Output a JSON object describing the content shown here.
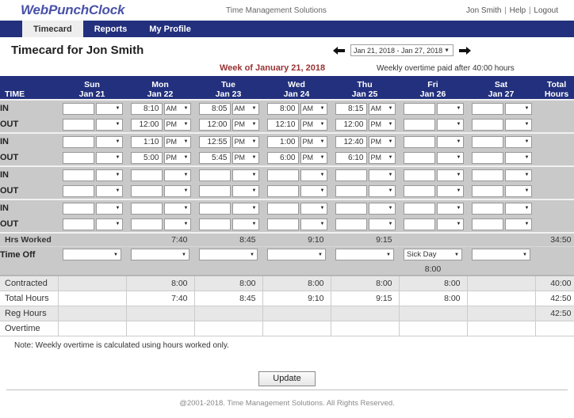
{
  "brand": {
    "logo": "WebPunchClock",
    "tagline": "Time Management Solutions"
  },
  "user_links": {
    "name": "Jon Smith",
    "help": "Help",
    "logout": "Logout",
    "separator": "|"
  },
  "nav": {
    "tabs": [
      {
        "label": "Timecard",
        "active": true
      },
      {
        "label": "Reports",
        "active": false
      },
      {
        "label": "My Profile",
        "active": false
      }
    ]
  },
  "page": {
    "title": "Timecard for Jon Smith",
    "week_label": "Week of January 21, 2018",
    "overtime_note": "Weekly overtime paid after 40:00 hours",
    "footer_note": "Note: Weekly overtime is calculated using hours worked only.",
    "update_button": "Update",
    "copyright": "@2001-2018. Time Management Solutions. All Rights Reserved."
  },
  "date_nav": {
    "prev_icon": "left-arrow-icon",
    "next_icon": "right-arrow-icon",
    "selected_range": "Jan 21, 2018 - Jan 27, 2018",
    "caret": "▼"
  },
  "colors": {
    "brand_blue": "#23307d",
    "logo_purple": "#4a52a8",
    "week_red": "#993333",
    "row_gray": "#c9c9c9",
    "summary_shade": "#e7e7e7"
  },
  "table": {
    "time_column_header": "TIME",
    "total_header_line1": "Total",
    "total_header_line2": "Hours",
    "days": [
      {
        "dow": "Sun",
        "date": "Jan 21"
      },
      {
        "dow": "Mon",
        "date": "Jan 22"
      },
      {
        "dow": "Tue",
        "date": "Jan 23"
      },
      {
        "dow": "Wed",
        "date": "Jan 24"
      },
      {
        "dow": "Thu",
        "date": "Jan 25"
      },
      {
        "dow": "Fri",
        "date": "Jan 26"
      },
      {
        "dow": "Sat",
        "date": "Jan 27"
      }
    ],
    "punch_rows": [
      {
        "label": "IN",
        "cells": [
          {
            "time": "",
            "meridiem": ""
          },
          {
            "time": "8:10",
            "meridiem": "AM"
          },
          {
            "time": "8:05",
            "meridiem": "AM"
          },
          {
            "time": "8:00",
            "meridiem": "AM"
          },
          {
            "time": "8:15",
            "meridiem": "AM"
          },
          {
            "time": "",
            "meridiem": ""
          },
          {
            "time": "",
            "meridiem": ""
          }
        ],
        "total": ""
      },
      {
        "label": "OUT",
        "cells": [
          {
            "time": "",
            "meridiem": ""
          },
          {
            "time": "12:00",
            "meridiem": "PM"
          },
          {
            "time": "12:00",
            "meridiem": "PM"
          },
          {
            "time": "12:10",
            "meridiem": "PM"
          },
          {
            "time": "12:00",
            "meridiem": "PM"
          },
          {
            "time": "",
            "meridiem": ""
          },
          {
            "time": "",
            "meridiem": ""
          }
        ],
        "total": ""
      },
      {
        "label": "IN",
        "cells": [
          {
            "time": "",
            "meridiem": ""
          },
          {
            "time": "1:10",
            "meridiem": "PM"
          },
          {
            "time": "12:55",
            "meridiem": "PM"
          },
          {
            "time": "1:00",
            "meridiem": "PM"
          },
          {
            "time": "12:40",
            "meridiem": "PM"
          },
          {
            "time": "",
            "meridiem": ""
          },
          {
            "time": "",
            "meridiem": ""
          }
        ],
        "total": ""
      },
      {
        "label": "OUT",
        "cells": [
          {
            "time": "",
            "meridiem": ""
          },
          {
            "time": "5:00",
            "meridiem": "PM"
          },
          {
            "time": "5:45",
            "meridiem": "PM"
          },
          {
            "time": "6:00",
            "meridiem": "PM"
          },
          {
            "time": "6:10",
            "meridiem": "PM"
          },
          {
            "time": "",
            "meridiem": ""
          },
          {
            "time": "",
            "meridiem": ""
          }
        ],
        "total": ""
      },
      {
        "label": "IN",
        "cells": [
          {
            "time": "",
            "meridiem": ""
          },
          {
            "time": "",
            "meridiem": ""
          },
          {
            "time": "",
            "meridiem": ""
          },
          {
            "time": "",
            "meridiem": ""
          },
          {
            "time": "",
            "meridiem": ""
          },
          {
            "time": "",
            "meridiem": ""
          },
          {
            "time": "",
            "meridiem": ""
          }
        ],
        "total": ""
      },
      {
        "label": "OUT",
        "cells": [
          {
            "time": "",
            "meridiem": ""
          },
          {
            "time": "",
            "meridiem": ""
          },
          {
            "time": "",
            "meridiem": ""
          },
          {
            "time": "",
            "meridiem": ""
          },
          {
            "time": "",
            "meridiem": ""
          },
          {
            "time": "",
            "meridiem": ""
          },
          {
            "time": "",
            "meridiem": ""
          }
        ],
        "total": ""
      },
      {
        "label": "IN",
        "cells": [
          {
            "time": "",
            "meridiem": ""
          },
          {
            "time": "",
            "meridiem": ""
          },
          {
            "time": "",
            "meridiem": ""
          },
          {
            "time": "",
            "meridiem": ""
          },
          {
            "time": "",
            "meridiem": ""
          },
          {
            "time": "",
            "meridiem": ""
          },
          {
            "time": "",
            "meridiem": ""
          }
        ],
        "total": ""
      },
      {
        "label": "OUT",
        "cells": [
          {
            "time": "",
            "meridiem": ""
          },
          {
            "time": "",
            "meridiem": ""
          },
          {
            "time": "",
            "meridiem": ""
          },
          {
            "time": "",
            "meridiem": ""
          },
          {
            "time": "",
            "meridiem": ""
          },
          {
            "time": "",
            "meridiem": ""
          },
          {
            "time": "",
            "meridiem": ""
          }
        ],
        "total": ""
      }
    ],
    "hrs_worked": {
      "label": "Hrs Worked",
      "values": [
        "",
        "7:40",
        "8:45",
        "9:10",
        "9:15",
        "",
        ""
      ],
      "total": "34:50"
    },
    "time_off": {
      "label": "Time Off",
      "values": [
        "",
        "",
        "",
        "",
        "",
        "Sick Day",
        ""
      ],
      "hours": [
        "",
        "",
        "",
        "",
        "",
        "8:00",
        ""
      ],
      "total": ""
    },
    "summary_rows": [
      {
        "label": "Contracted",
        "values": [
          "",
          "8:00",
          "8:00",
          "8:00",
          "8:00",
          "8:00",
          ""
        ],
        "total": "40:00",
        "shaded": true
      },
      {
        "label": "Total Hours",
        "values": [
          "",
          "7:40",
          "8:45",
          "9:10",
          "9:15",
          "8:00",
          ""
        ],
        "total": "42:50",
        "shaded": false
      },
      {
        "label": "Reg Hours",
        "values": [
          "",
          "",
          "",
          "",
          "",
          "",
          ""
        ],
        "total": "42:50",
        "shaded": true
      },
      {
        "label": "Overtime",
        "values": [
          "",
          "",
          "",
          "",
          "",
          "",
          ""
        ],
        "total": "",
        "shaded": false
      }
    ]
  }
}
